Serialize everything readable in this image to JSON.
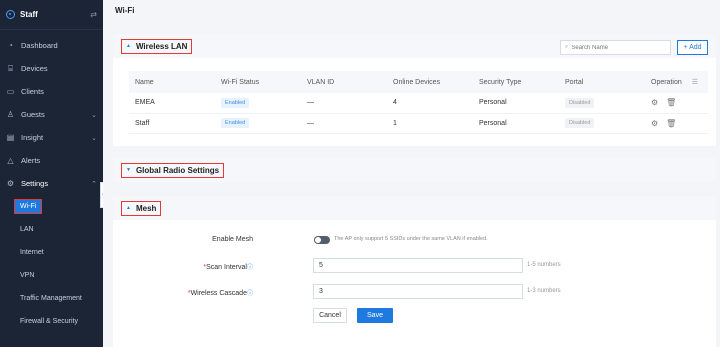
{
  "sidebar": {
    "site": "Staff",
    "switch_icon": "swap-icon",
    "items": [
      {
        "label": "Dashboard",
        "icon": "dashboard-icon"
      },
      {
        "label": "Devices",
        "icon": "devices-icon"
      },
      {
        "label": "Clients",
        "icon": "clients-icon"
      },
      {
        "label": "Guests",
        "icon": "guests-icon"
      },
      {
        "label": "Insight",
        "icon": "insight-icon"
      },
      {
        "label": "Alerts",
        "icon": "alerts-icon"
      },
      {
        "label": "Settings",
        "icon": "gear-icon"
      }
    ],
    "sub_items": [
      {
        "label": "Wi-Fi"
      },
      {
        "label": "LAN"
      },
      {
        "label": "Internet"
      },
      {
        "label": "VPN"
      },
      {
        "label": "Traffic Management"
      },
      {
        "label": "Firewall & Security"
      }
    ]
  },
  "page": {
    "title": "Wi-Fi"
  },
  "wireless_lan": {
    "title": "Wireless LAN",
    "search_placeholder": "Search Name",
    "add_label": "+ Add",
    "columns": [
      "Name",
      "Wi-Fi Status",
      "VLAN ID",
      "Online Devices",
      "Security Type",
      "Portal",
      "Operation"
    ],
    "rows": [
      {
        "name": "EMEA",
        "status": "Enabled",
        "vlan": "—",
        "online": "4",
        "security": "Personal",
        "portal": "Disabled"
      },
      {
        "name": "Staff",
        "status": "Enabled",
        "vlan": "—",
        "online": "1",
        "security": "Personal",
        "portal": "Disabled"
      }
    ]
  },
  "global_radio": {
    "title": "Global Radio Settings"
  },
  "mesh": {
    "title": "Mesh",
    "enable_label": "Enable Mesh",
    "enable_note": "The AP only support 5 SSIDs under the same VLAN if enabled.",
    "enable_on": false,
    "scan_label": "Scan Interval",
    "scan_value": "5",
    "scan_hint": "1-5 numbers",
    "cascade_label": "Wireless Cascade",
    "cascade_value": "3",
    "cascade_hint": "1-3 numbers",
    "cancel_label": "Cancel",
    "save_label": "Save"
  },
  "colors": {
    "accent": "#1f7ae0",
    "sidebar_bg": "#1b2536",
    "highlight": "#e53935"
  }
}
